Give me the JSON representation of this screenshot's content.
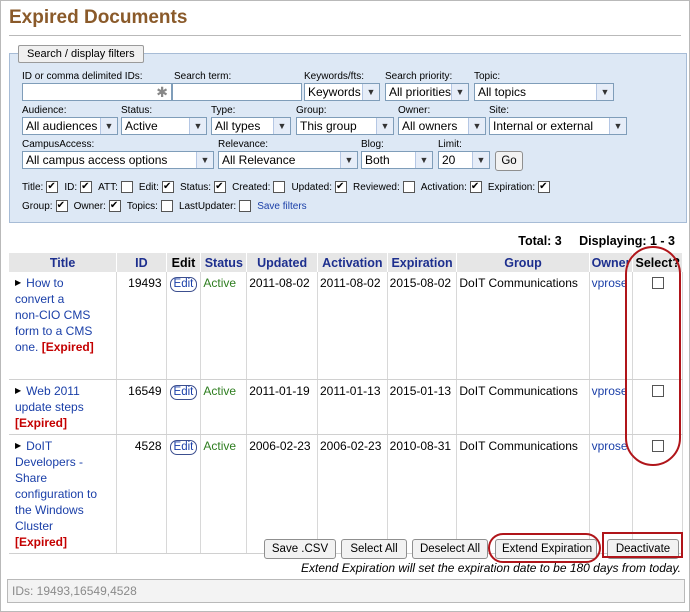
{
  "page": {
    "title": "Expired Documents"
  },
  "filters": {
    "legend": "Search / display filters",
    "ids_label": "ID or comma delimited IDs:",
    "ids_value": "",
    "search_label": "Search term:",
    "search_value": "",
    "keywords_label": "Keywords/fts:",
    "keywords_value": "Keywords",
    "priority_label": "Search priority:",
    "priority_value": "All priorities",
    "topic_label": "Topic:",
    "topic_value": "All topics",
    "audience_label": "Audience:",
    "audience_value": "All audiences",
    "status_label": "Status:",
    "status_value": "Active",
    "type_label": "Type:",
    "type_value": "All types",
    "group_label": "Group:",
    "group_value": "This group",
    "owner_label": "Owner:",
    "owner_value": "All owners",
    "site_label": "Site:",
    "site_value": "Internal or external",
    "campus_label": "CampusAccess:",
    "campus_value": "All campus access options",
    "relevance_label": "Relevance:",
    "relevance_value": "All Relevance",
    "blog_label": "Blog:",
    "blog_value": "Both",
    "limit_label": "Limit:",
    "limit_value": "20",
    "go_label": "Go",
    "columns": [
      {
        "label": "Title:",
        "checked": true
      },
      {
        "label": "ID:",
        "checked": true
      },
      {
        "label": "ATT:",
        "checked": false
      },
      {
        "label": "Edit:",
        "checked": true
      },
      {
        "label": "Status:",
        "checked": true
      },
      {
        "label": "Created:",
        "checked": false
      },
      {
        "label": "Updated:",
        "checked": true
      },
      {
        "label": "Reviewed:",
        "checked": false
      },
      {
        "label": "Activation:",
        "checked": true
      },
      {
        "label": "Expiration:",
        "checked": true
      },
      {
        "label": "Group:",
        "checked": true
      },
      {
        "label": "Owner:",
        "checked": true
      },
      {
        "label": "Topics:",
        "checked": false
      },
      {
        "label": "LastUpdater:",
        "checked": false
      }
    ],
    "save_filters": "Save filters"
  },
  "summary": {
    "total": "Total: 3",
    "displaying": "Displaying: 1 - 3"
  },
  "table": {
    "headers": [
      "Title",
      "ID",
      "Edit",
      "Status",
      "Updated",
      "Activation",
      "Expiration",
      "Group",
      "Owner",
      "Select?"
    ],
    "rows": [
      {
        "title_lines": [
          "How to",
          "convert a",
          "non-CIO CMS",
          "form to a CMS",
          "one."
        ],
        "expired": "[Expired]",
        "id": "19493",
        "edit": "Edit",
        "status": "Active",
        "updated": "2011-08-02",
        "activation": "2011-08-02",
        "expiration": "2015-08-02",
        "group": "DoIT Communications",
        "owner": "vprose"
      },
      {
        "title_lines": [
          "Web 2011",
          "update steps"
        ],
        "expired": "[Expired]",
        "id": "16549",
        "edit": "Edit",
        "status": "Active",
        "updated": "2011-01-19",
        "activation": "2011-01-13",
        "expiration": "2015-01-13",
        "group": "DoIT Communications",
        "owner": "vprose"
      },
      {
        "title_lines": [
          "DoIT",
          "Developers -",
          "Share",
          "configuration to",
          "the Windows",
          "Cluster"
        ],
        "expired": "[Expired]",
        "id": "4528",
        "edit": "Edit",
        "status": "Active",
        "updated": "2006-02-23",
        "activation": "2006-02-23",
        "expiration": "2010-08-31",
        "group": "DoIT Communications",
        "owner": "vprose"
      }
    ]
  },
  "actions": {
    "save_csv": "Save .CSV",
    "select_all": "Select All",
    "deselect_all": "Deselect All",
    "extend_expiration": "Extend Expiration",
    "deactivate": "Deactivate"
  },
  "note": "Extend Expiration will set the expiration date to be 180 days from today.",
  "ids_bar": "IDs: 19493,16549,4528",
  "colors": {
    "title": "#8a5a2a",
    "header_text": "#1d2f8e",
    "link": "#1a3fa8",
    "expired": "#c40000",
    "active": "#2e7d1f",
    "highlight": "#b0151a",
    "filter_bg": "#dde8f5"
  }
}
